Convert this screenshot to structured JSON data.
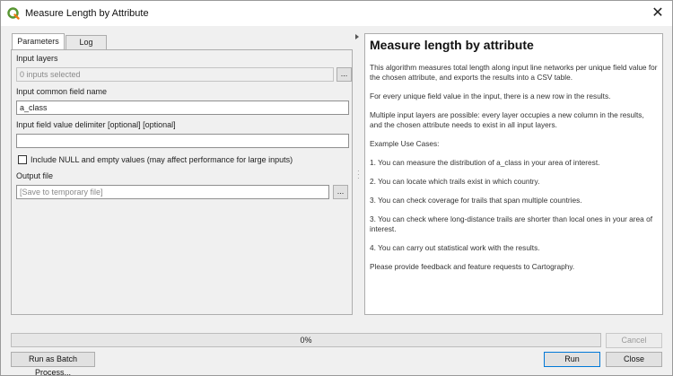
{
  "window": {
    "title": "Measure Length by Attribute",
    "close_glyph": "✕"
  },
  "tabs": [
    {
      "label": "Parameters",
      "active": true
    },
    {
      "label": "Log",
      "active": false
    }
  ],
  "params": {
    "input_layers_label": "Input layers",
    "input_layers_value": "0 inputs selected",
    "browse_label": "...",
    "field_name_label": "Input common field name",
    "field_name_value": "a_class",
    "delimiter_label": "Input field value delimiter [optional] [optional]",
    "delimiter_value": "",
    "include_null_label": "Include NULL and empty values (may affect performance for large inputs)",
    "include_null_checked": false,
    "output_label": "Output file",
    "output_placeholder": "[Save to temporary file]",
    "output_browse_label": "..."
  },
  "help": {
    "title": "Measure length by attribute",
    "paragraphs": [
      "This algorithm measures total length along input line networks per unique field value for the chosen attribute, and exports the results into a CSV table.",
      "For every unique field value in the input, there is a new row in the results.",
      "Multiple input layers are possible: every layer occupies a new column in the results, and the chosen attribute needs to exist in all input layers.",
      "Example Use Cases:",
      "1. You can measure the distribution of a_class in your area of interest.",
      "2. You can locate which trails exist in which country.",
      "3. You can check coverage for trails that span multiple countries.",
      "3. You can check where long-distance trails are shorter than local ones in your area of interest.",
      "4. You can carry out statistical work with the results.",
      "Please provide feedback and feature requests to Cartography."
    ]
  },
  "footer": {
    "progress_text": "0%",
    "progress_value": 0,
    "cancel_label": "Cancel",
    "batch_label": "Run as Batch Process...",
    "run_label": "Run",
    "close_label": "Close"
  },
  "colors": {
    "qgis_green": "#589632",
    "qgis_yellow": "#ee7913",
    "focus_blue": "#0078d7"
  }
}
